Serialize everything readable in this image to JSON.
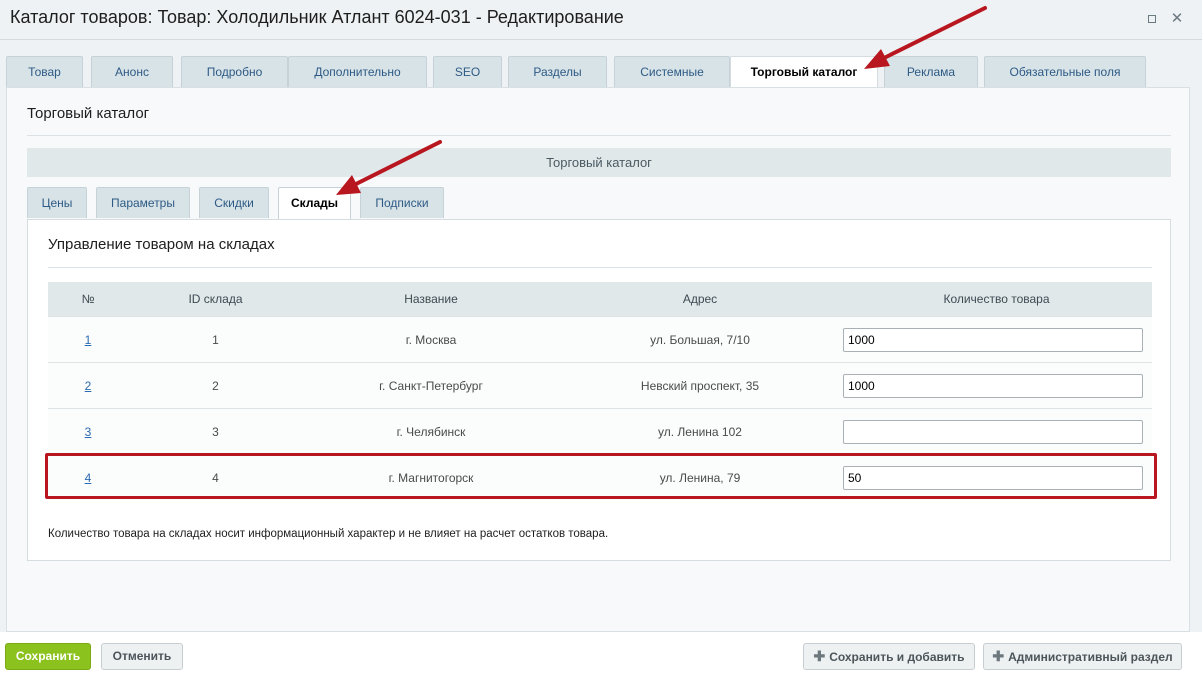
{
  "window": {
    "title": "Каталог товаров: Товар: Холодильник Атлант 6024-031 - Редактирование"
  },
  "tabs": [
    {
      "label": "Товар"
    },
    {
      "label": "Анонс"
    },
    {
      "label": "Подробно"
    },
    {
      "label": "Дополнительно"
    },
    {
      "label": "SEO"
    },
    {
      "label": "Разделы"
    },
    {
      "label": "Системные"
    },
    {
      "label": "Торговый каталог",
      "active": true
    },
    {
      "label": "Реклама"
    },
    {
      "label": "Обязательные поля"
    }
  ],
  "panel": {
    "heading": "Торговый каталог",
    "bar_title": "Торговый каталог"
  },
  "subtabs": [
    {
      "label": "Цены"
    },
    {
      "label": "Параметры"
    },
    {
      "label": "Скидки"
    },
    {
      "label": "Склады",
      "active": true
    },
    {
      "label": "Подписки"
    }
  ],
  "stores": {
    "heading": "Управление товаром на складах",
    "columns": [
      "№",
      "ID склада",
      "Название",
      "Адрес",
      "Количество товара"
    ],
    "rows": [
      {
        "num": "1",
        "id": "1",
        "name": "г. Москва",
        "address": "ул. Большая, 7/10",
        "qty": "1000"
      },
      {
        "num": "2",
        "id": "2",
        "name": "г. Санкт-Петербург",
        "address": "Невский проспект, 35",
        "qty": "1000"
      },
      {
        "num": "3",
        "id": "3",
        "name": "г. Челябинск",
        "address": "ул. Ленина 102",
        "qty": ""
      },
      {
        "num": "4",
        "id": "4",
        "name": "г. Магнитогорск",
        "address": "ул. Ленина, 79",
        "qty": "50"
      }
    ],
    "notice": "Количество товара на складах носит информационный характер и не влияет на расчет остатков товара."
  },
  "footer": {
    "save": "Сохранить",
    "cancel": "Отменить",
    "save_add": "Сохранить и добавить",
    "admin": "Административный раздел"
  },
  "colors": {
    "accent_green": "#8bc21d",
    "annotation_red": "#b8171f",
    "link_blue": "#2c6bb2"
  }
}
